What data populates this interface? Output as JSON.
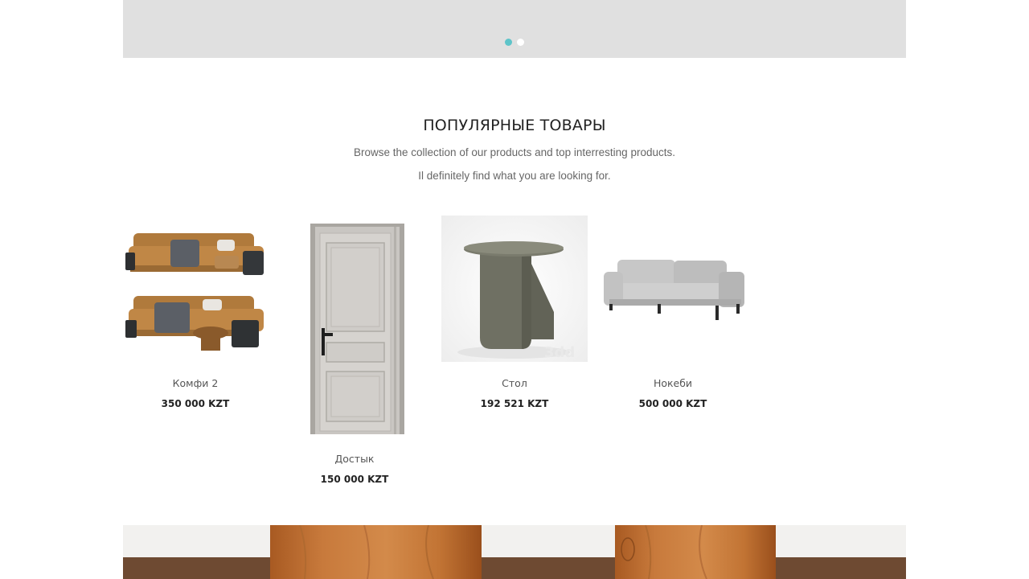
{
  "slider": {
    "dots": 2,
    "active_index": 0
  },
  "popular": {
    "title": "ПОПУЛЯРНЫЕ ТОВАРЫ",
    "subtitle_line1": "Browse the collection of our products and top interresting products.",
    "subtitle_line2": "Il definitely find what you are looking for."
  },
  "products": [
    {
      "name": "Комфи 2",
      "price": "350 000 KZT"
    },
    {
      "name": "Достык",
      "price": "150 000 KZT"
    },
    {
      "name": "Стол",
      "price": "192 521 KZT"
    },
    {
      "name": "Нокеби",
      "price": "500 000 KZT"
    }
  ],
  "colors": {
    "accent_dot": "#5ec4c9",
    "banner_bg": "#e0e0e0"
  }
}
